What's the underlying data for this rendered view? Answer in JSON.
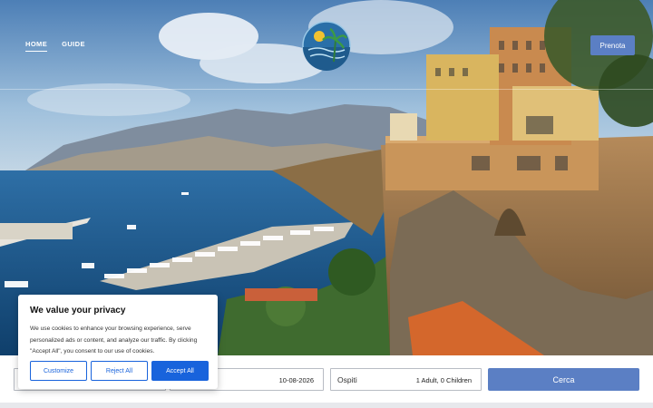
{
  "header": {
    "nav": [
      {
        "label": "HOME",
        "active": true
      },
      {
        "label": "GUIDE",
        "active": false
      }
    ],
    "book_label": "Prenota",
    "logo_icon": "sun-palm-sea-logo"
  },
  "booking": {
    "checkout_value": "10-08-2026",
    "guests_label": "Ospiti",
    "guests_value": "1 Adult, 0 Children",
    "search_label": "Cerca"
  },
  "cookie": {
    "title": "We value your privacy",
    "text": "We use cookies to enhance your browsing experience, serve personalized ads or content, and analyze our traffic. By clicking \"Accept All\", you consent to our use of cookies.",
    "customize": "Customize",
    "reject": "Reject All",
    "accept": "Accept All"
  },
  "colors": {
    "accent": "#5b7fc4",
    "cookie_primary": "#1863dc"
  }
}
